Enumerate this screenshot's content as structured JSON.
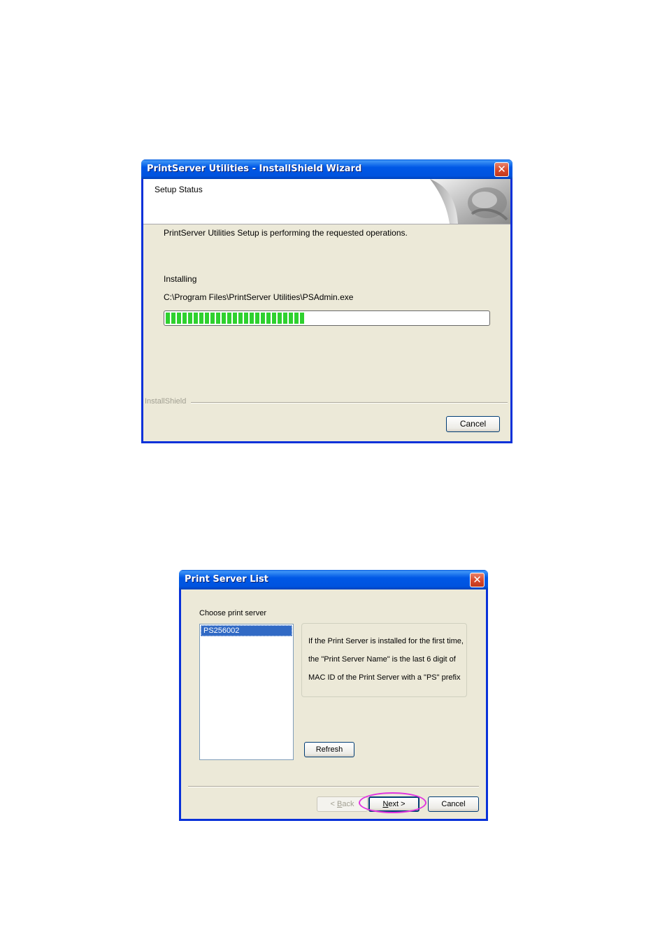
{
  "installer": {
    "title": "PrintServer Utilities - InstallShield Wizard",
    "close_glyph": "✕",
    "header_title": "Setup Status",
    "status_message": "PrintServer Utilities Setup is performing the requested operations.",
    "action_label": "Installing",
    "file_path": "C:\\Program Files\\PrintServer Utilities\\PSAdmin.exe",
    "progress_fraction": 0.44,
    "progress_color": "#2fd12f",
    "brand_label": "InstallShield",
    "cancel_label": "Cancel"
  },
  "server_list": {
    "title": "Print Server List",
    "close_glyph": "✕",
    "choose_label": "Choose print server",
    "servers": [
      "PS256002"
    ],
    "selected_index": 0,
    "info_lines": [
      "If the Print Server is installed for the first time,",
      "the \"Print Server Name\" is the last 6 digit of",
      "MAC ID of the Print Server with a \"PS\" prefix"
    ],
    "refresh_label": "Refresh",
    "back_prefix": "< ",
    "back_mnemonic": "B",
    "back_rest": "ack",
    "next_mnemonic": "N",
    "next_rest": "ext >",
    "cancel_label": "Cancel",
    "highlight_color": "#e033e0"
  },
  "colors": {
    "titlebar": "#0054e3",
    "dialog_bg": "#ece9d8",
    "selection": "#316ac5"
  }
}
